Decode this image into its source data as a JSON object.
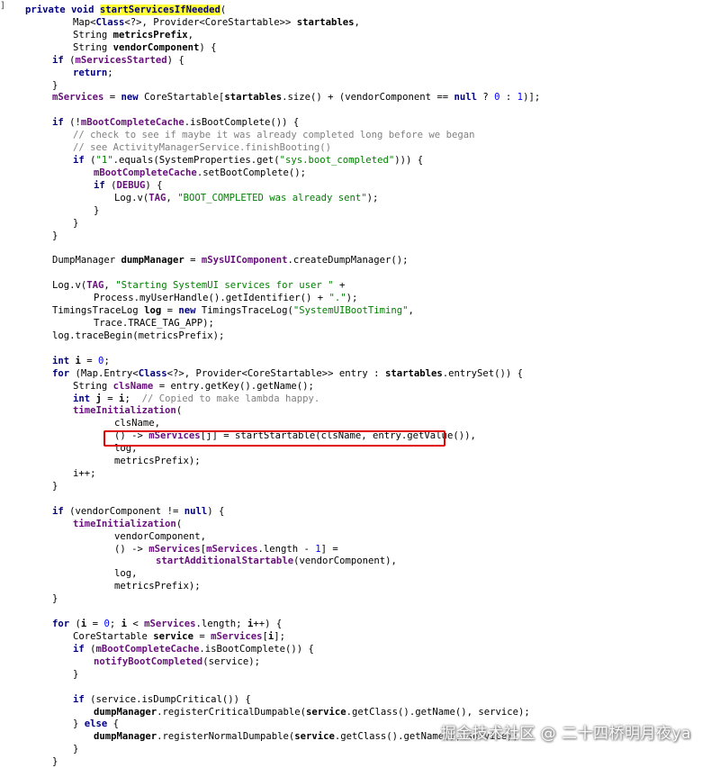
{
  "gutter_mark": "]",
  "watermark": "掘金技术社区 @ 二十四桥明月夜ya",
  "colors": {
    "keyword": "#000080",
    "field": "#660e7a",
    "string": "#008000",
    "comment": "#808080",
    "method_highlight_bg": "#ffff33",
    "red_box": "#e00000"
  },
  "code_lines": [
    {
      "indent": 0,
      "tokens": [
        [
          "kw",
          "private "
        ],
        [
          "kw",
          "void "
        ],
        [
          "hl",
          "startServicesIfNeeded"
        ],
        [
          "ident",
          "("
        ]
      ]
    },
    {
      "indent": 3,
      "tokens": [
        [
          "ident",
          "Map<"
        ],
        [
          "kw",
          "Class"
        ],
        [
          "ident",
          "<?>, Provider<CoreStartable>> "
        ],
        [
          "bold",
          "startables"
        ],
        [
          "ident",
          ","
        ]
      ]
    },
    {
      "indent": 3,
      "tokens": [
        [
          "ident",
          "String "
        ],
        [
          "bold",
          "metricsPrefix"
        ],
        [
          "ident",
          ","
        ]
      ]
    },
    {
      "indent": 3,
      "tokens": [
        [
          "ident",
          "String "
        ],
        [
          "bold",
          "vendorComponent"
        ],
        [
          "ident",
          ") {"
        ]
      ]
    },
    {
      "indent": 2,
      "tokens": [
        [
          "kw",
          "if "
        ],
        [
          "ident",
          "("
        ],
        [
          "field",
          "mServicesStarted"
        ],
        [
          "ident",
          ") {"
        ]
      ]
    },
    {
      "indent": 3,
      "tokens": [
        [
          "kw",
          "return"
        ],
        [
          "ident",
          ";"
        ]
      ]
    },
    {
      "indent": 2,
      "tokens": [
        [
          "ident",
          "}"
        ]
      ]
    },
    {
      "indent": 2,
      "tokens": [
        [
          "field",
          "mServices"
        ],
        [
          "ident",
          " = "
        ],
        [
          "kw",
          "new "
        ],
        [
          "ident",
          "CoreStartable["
        ],
        [
          "bold",
          "startables"
        ],
        [
          "ident",
          ".size() + (vendorComponent == "
        ],
        [
          "kw",
          "null "
        ],
        [
          "ident",
          "? "
        ],
        [
          "num",
          "0 "
        ],
        [
          "ident",
          ": "
        ],
        [
          "num",
          "1"
        ],
        [
          "ident",
          ")];"
        ]
      ]
    },
    {
      "indent": 0,
      "tokens": []
    },
    {
      "indent": 2,
      "tokens": [
        [
          "kw",
          "if "
        ],
        [
          "ident",
          "(!"
        ],
        [
          "field",
          "mBootCompleteCache"
        ],
        [
          "ident",
          ".isBootComplete()) {"
        ]
      ]
    },
    {
      "indent": 3,
      "tokens": [
        [
          "comment",
          "// check to see if maybe it was already completed long before we began"
        ]
      ]
    },
    {
      "indent": 3,
      "tokens": [
        [
          "comment",
          "// see ActivityManagerService.finishBooting()"
        ]
      ]
    },
    {
      "indent": 3,
      "tokens": [
        [
          "kw",
          "if "
        ],
        [
          "ident",
          "("
        ],
        [
          "str",
          "\"1\""
        ],
        [
          "ident",
          ".equals(SystemProperties.get("
        ],
        [
          "str",
          "\"sys.boot_completed\""
        ],
        [
          "ident",
          "))) {"
        ]
      ]
    },
    {
      "indent": 4,
      "tokens": [
        [
          "field",
          "mBootCompleteCache"
        ],
        [
          "ident",
          ".setBootComplete();"
        ]
      ]
    },
    {
      "indent": 4,
      "tokens": [
        [
          "kw",
          "if "
        ],
        [
          "ident",
          "("
        ],
        [
          "field",
          "DEBUG"
        ],
        [
          "ident",
          ") {"
        ]
      ]
    },
    {
      "indent": 5,
      "tokens": [
        [
          "ident",
          "Log.v("
        ],
        [
          "field",
          "TAG"
        ],
        [
          "ident",
          ", "
        ],
        [
          "str",
          "\"BOOT_COMPLETED was already sent\""
        ],
        [
          "ident",
          ");"
        ]
      ]
    },
    {
      "indent": 4,
      "tokens": [
        [
          "ident",
          "}"
        ]
      ]
    },
    {
      "indent": 3,
      "tokens": [
        [
          "ident",
          "}"
        ]
      ]
    },
    {
      "indent": 2,
      "tokens": [
        [
          "ident",
          "}"
        ]
      ]
    },
    {
      "indent": 0,
      "tokens": []
    },
    {
      "indent": 2,
      "tokens": [
        [
          "ident",
          "DumpManager "
        ],
        [
          "bold",
          "dumpManager"
        ],
        [
          "ident",
          " = "
        ],
        [
          "field",
          "mSysUIComponent"
        ],
        [
          "ident",
          ".createDumpManager();"
        ]
      ]
    },
    {
      "indent": 0,
      "tokens": []
    },
    {
      "indent": 2,
      "tokens": [
        [
          "ident",
          "Log.v("
        ],
        [
          "field",
          "TAG"
        ],
        [
          "ident",
          ", "
        ],
        [
          "str",
          "\"Starting SystemUI services for user \" "
        ],
        [
          "ident",
          "+"
        ]
      ]
    },
    {
      "indent": 4,
      "tokens": [
        [
          "ident",
          "Process.myUserHandle().getIdentifier() + "
        ],
        [
          "str",
          "\".\""
        ],
        [
          "ident",
          ");"
        ]
      ]
    },
    {
      "indent": 2,
      "tokens": [
        [
          "ident",
          "TimingsTraceLog "
        ],
        [
          "bold",
          "log"
        ],
        [
          "ident",
          " = "
        ],
        [
          "kw",
          "new "
        ],
        [
          "ident",
          "TimingsTraceLog("
        ],
        [
          "str",
          "\"SystemUIBootTiming\""
        ],
        [
          "ident",
          ","
        ]
      ]
    },
    {
      "indent": 4,
      "tokens": [
        [
          "ident",
          "Trace.TRACE_TAG_APP);"
        ]
      ]
    },
    {
      "indent": 2,
      "tokens": [
        [
          "ident",
          "log.traceBegin(metricsPrefix);"
        ]
      ]
    },
    {
      "indent": 0,
      "tokens": []
    },
    {
      "indent": 2,
      "tokens": [
        [
          "kw",
          "int "
        ],
        [
          "bold",
          "i"
        ],
        [
          "ident",
          " = "
        ],
        [
          "num",
          "0"
        ],
        [
          "ident",
          ";"
        ]
      ]
    },
    {
      "indent": 2,
      "tokens": [
        [
          "kw",
          "for "
        ],
        [
          "ident",
          "(Map.Entry<"
        ],
        [
          "kw",
          "Class"
        ],
        [
          "ident",
          "<?>, Provider<CoreStartable>> entry : "
        ],
        [
          "bold",
          "startables"
        ],
        [
          "ident",
          ".entrySet()) {"
        ]
      ]
    },
    {
      "indent": 3,
      "tokens": [
        [
          "ident",
          "String "
        ],
        [
          "field",
          "clsName"
        ],
        [
          "ident",
          " = entry.getKey().getName();"
        ]
      ]
    },
    {
      "indent": 3,
      "tokens": [
        [
          "kw",
          "int "
        ],
        [
          "bold",
          "j"
        ],
        [
          "ident",
          " = "
        ],
        [
          "bold",
          "i"
        ],
        [
          "ident",
          ";  "
        ],
        [
          "comment",
          "// Copied to make lambda happy."
        ]
      ]
    },
    {
      "indent": 3,
      "tokens": [
        [
          "field",
          "timeInitialization"
        ],
        [
          "ident",
          "("
        ]
      ]
    },
    {
      "indent": 5,
      "tokens": [
        [
          "ident",
          "clsName,"
        ]
      ]
    },
    {
      "indent": 5,
      "tokens": [
        [
          "ident",
          "() -> "
        ],
        [
          "field",
          "mServices"
        ],
        [
          "ident",
          "[j] = startStartable(clsName, entry.getValue()),"
        ]
      ]
    },
    {
      "indent": 5,
      "tokens": [
        [
          "ident",
          "log,"
        ]
      ]
    },
    {
      "indent": 5,
      "tokens": [
        [
          "ident",
          "metricsPrefix);"
        ]
      ]
    },
    {
      "indent": 3,
      "tokens": [
        [
          "ident",
          "i++;"
        ]
      ]
    },
    {
      "indent": 2,
      "tokens": [
        [
          "ident",
          "}"
        ]
      ]
    },
    {
      "indent": 0,
      "tokens": []
    },
    {
      "indent": 2,
      "tokens": [
        [
          "kw",
          "if "
        ],
        [
          "ident",
          "(vendorComponent != "
        ],
        [
          "kw",
          "null"
        ],
        [
          "ident",
          ") {"
        ]
      ]
    },
    {
      "indent": 3,
      "tokens": [
        [
          "field",
          "timeInitialization"
        ],
        [
          "ident",
          "("
        ]
      ]
    },
    {
      "indent": 5,
      "tokens": [
        [
          "ident",
          "vendorComponent,"
        ]
      ]
    },
    {
      "indent": 5,
      "tokens": [
        [
          "ident",
          "() -> "
        ],
        [
          "field",
          "mServices"
        ],
        [
          "ident",
          "["
        ],
        [
          "field",
          "mServices"
        ],
        [
          "ident",
          ".length - "
        ],
        [
          "num",
          "1"
        ],
        [
          "ident",
          "] ="
        ]
      ]
    },
    {
      "indent": 7,
      "tokens": [
        [
          "field",
          "startAdditionalStartable"
        ],
        [
          "ident",
          "(vendorComponent),"
        ]
      ]
    },
    {
      "indent": 5,
      "tokens": [
        [
          "ident",
          "log,"
        ]
      ]
    },
    {
      "indent": 5,
      "tokens": [
        [
          "ident",
          "metricsPrefix);"
        ]
      ]
    },
    {
      "indent": 2,
      "tokens": [
        [
          "ident",
          "}"
        ]
      ]
    },
    {
      "indent": 0,
      "tokens": []
    },
    {
      "indent": 2,
      "tokens": [
        [
          "kw",
          "for "
        ],
        [
          "ident",
          "("
        ],
        [
          "bold",
          "i"
        ],
        [
          "ident",
          " = "
        ],
        [
          "num",
          "0"
        ],
        [
          "ident",
          "; "
        ],
        [
          "bold",
          "i"
        ],
        [
          "ident",
          " < "
        ],
        [
          "field",
          "mServices"
        ],
        [
          "ident",
          ".length; "
        ],
        [
          "bold",
          "i"
        ],
        [
          "ident",
          "++) {"
        ]
      ]
    },
    {
      "indent": 3,
      "tokens": [
        [
          "ident",
          "CoreStartable "
        ],
        [
          "bold",
          "service"
        ],
        [
          "ident",
          " = "
        ],
        [
          "field",
          "mServices"
        ],
        [
          "ident",
          "["
        ],
        [
          "bold",
          "i"
        ],
        [
          "ident",
          "];"
        ]
      ]
    },
    {
      "indent": 3,
      "tokens": [
        [
          "kw",
          "if "
        ],
        [
          "ident",
          "("
        ],
        [
          "field",
          "mBootCompleteCache"
        ],
        [
          "ident",
          ".isBootComplete()) {"
        ]
      ]
    },
    {
      "indent": 4,
      "tokens": [
        [
          "field",
          "notifyBootCompleted"
        ],
        [
          "ident",
          "(service);"
        ]
      ]
    },
    {
      "indent": 3,
      "tokens": [
        [
          "ident",
          "}"
        ]
      ]
    },
    {
      "indent": 0,
      "tokens": []
    },
    {
      "indent": 3,
      "tokens": [
        [
          "kw",
          "if "
        ],
        [
          "ident",
          "(service.isDumpCritical()) {"
        ]
      ]
    },
    {
      "indent": 4,
      "tokens": [
        [
          "bold",
          "dumpManager"
        ],
        [
          "ident",
          ".registerCriticalDumpable("
        ],
        [
          "bold",
          "service"
        ],
        [
          "ident",
          ".getClass().getName(), service);"
        ]
      ]
    },
    {
      "indent": 3,
      "tokens": [
        [
          "ident",
          "} "
        ],
        [
          "kw",
          "else "
        ],
        [
          "ident",
          "{"
        ]
      ]
    },
    {
      "indent": 4,
      "tokens": [
        [
          "bold",
          "dumpManager"
        ],
        [
          "ident",
          ".registerNormalDumpable("
        ],
        [
          "bold",
          "service"
        ],
        [
          "ident",
          ".getClass().getName(), service);"
        ]
      ]
    },
    {
      "indent": 3,
      "tokens": [
        [
          "ident",
          "}"
        ]
      ]
    },
    {
      "indent": 2,
      "tokens": [
        [
          "ident",
          "}"
        ]
      ]
    }
  ]
}
